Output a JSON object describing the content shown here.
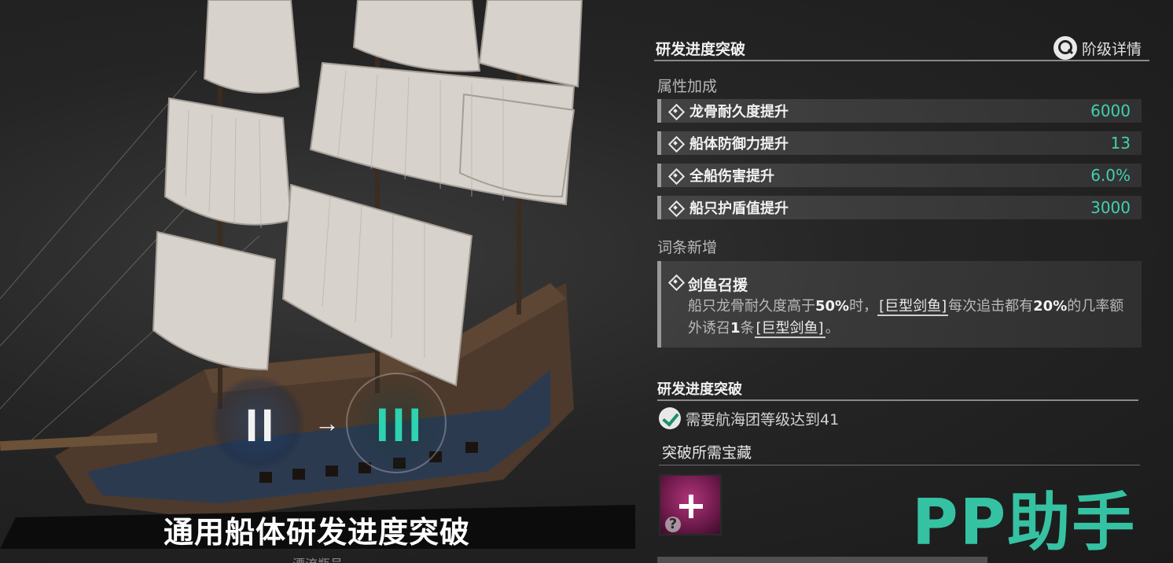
{
  "colors": {
    "accent": "#2ed3b0",
    "value_text": "#3fd1b0",
    "watermark": "#35c2a2",
    "treasure_bg": "#8a2260"
  },
  "tier": {
    "from": "II",
    "arrow": "→",
    "to": "III"
  },
  "caption": {
    "title": "通用船体研发进度突破",
    "subtitle": "漂流瓶号"
  },
  "panel": {
    "title": "研发进度突破",
    "tier_detail_label": "阶级详情",
    "tier_detail_icon": "magnifier-icon"
  },
  "attributes": {
    "label": "属性加成",
    "rows": [
      {
        "name": "龙骨耐久度提升",
        "value": "6000"
      },
      {
        "name": "船体防御力提升",
        "value": "13"
      },
      {
        "name": "全船伤害提升",
        "value": "6.0%"
      },
      {
        "name": "船只护盾值提升",
        "value": "3000"
      }
    ]
  },
  "entries": {
    "label": "词条新增",
    "name": "剑鱼召援",
    "desc": {
      "p1": "船只龙骨耐久度高于",
      "v1": "50%",
      "p2": "时，",
      "tag1": "[巨型剑鱼]",
      "p3": "每次追击都有",
      "v2": "20%",
      "p4": "的几率额外诱召",
      "v3": "1",
      "p5": "条",
      "tag2": "[巨型剑鱼]",
      "p6": "。"
    }
  },
  "breakthrough": {
    "title": "研发进度突破",
    "requirement": "需要航海团等级达到41",
    "requirement_icon": "checkmark-icon",
    "treasure_title": "突破所需宝藏",
    "treasure_icon": "add-treasure-icon"
  },
  "watermark": "PP助手"
}
